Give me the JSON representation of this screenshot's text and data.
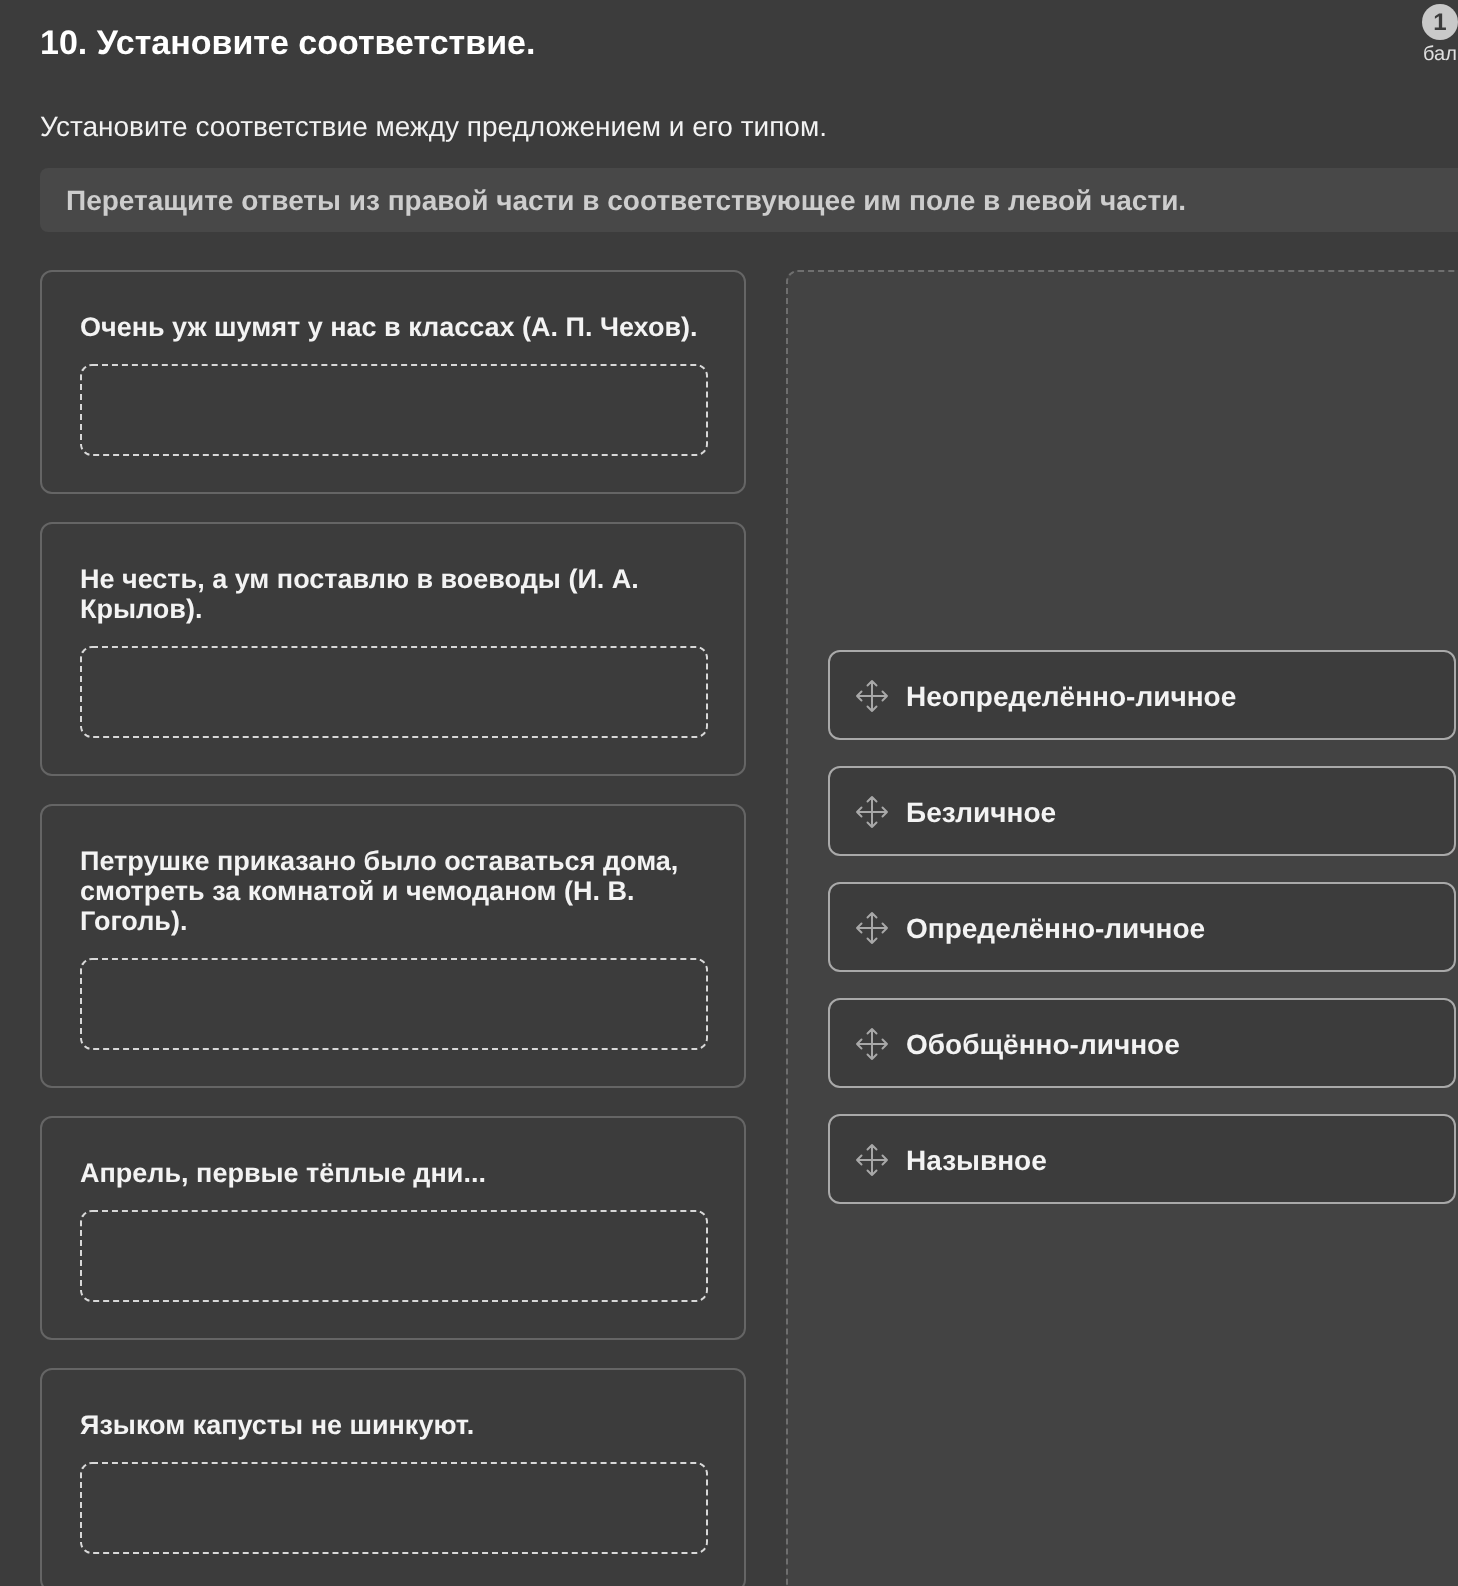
{
  "task": {
    "title": "10. Установите соответствие.",
    "score": {
      "value": "1",
      "label": "бал"
    }
  },
  "prompt": "Установите соответствие между предложением и его типом.",
  "instruction": "Перетащите ответы из правой части в соответствующее им поле в левой части.",
  "questions": [
    {
      "text": "Очень уж шумят у нас в классах (А. П. Чехов)."
    },
    {
      "text": "Не честь, а ум поставлю в воеводы (И. А. Крылов)."
    },
    {
      "text": "Петрушке приказано было оставаться дома, смотреть за комнатой и чемоданом (Н. В. Гоголь)."
    },
    {
      "text": "Апрель, первые тёплые дни..."
    },
    {
      "text": "Языком капусты не шинкуют."
    }
  ],
  "answers": [
    {
      "label": "Неопределённо-личное"
    },
    {
      "label": "Безличное"
    },
    {
      "label": "Определённо-личное"
    },
    {
      "label": "Обобщённо-личное"
    },
    {
      "label": "Назывное"
    }
  ]
}
